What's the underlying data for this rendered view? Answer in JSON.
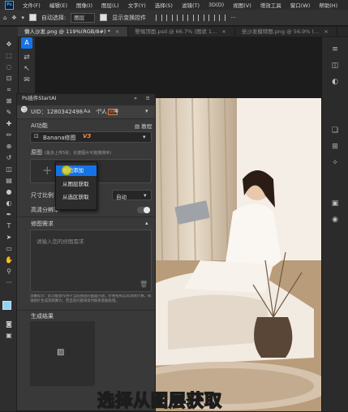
{
  "menubar": {
    "items": [
      "文件(F)",
      "编辑(E)",
      "图像(I)",
      "图层(L)",
      "文字(Y)",
      "选择(S)",
      "滤镜(T)",
      "3D(D)",
      "视图(V)",
      "增效工具",
      "窗口(W)",
      "帮助(H)"
    ]
  },
  "options": {
    "auto_select": "自动选择:",
    "layer_select": "图层",
    "show_transform": "显示变换控件"
  },
  "tabs": [
    {
      "label": "懒人沙发.png @ 119%(RGB/8#) *",
      "active": true
    },
    {
      "label": "警惕顶面.psd @ 66.7% (图状 1...",
      "active": false
    },
    {
      "label": "坐沙发模特图.png @ 56.9% (...",
      "active": false
    }
  ],
  "plugin": {
    "title": "Ps插件StartAI",
    "expand_label": "»",
    "menu_label": "≡",
    "uid_label": "UID：1280342498",
    "account_type": "个人",
    "vip_badge": "VIP",
    "ai_func_label": "AI功能",
    "tutorial_label": "教程",
    "model_name": "Banana修图",
    "model_badge": "V3",
    "original_label": "原图",
    "original_hint": "(最多上传5张，长按图片可拖拽排序)",
    "ratio_label": "尺寸比例",
    "ratio_value": "自动",
    "hires_label": "高清分辨率",
    "request_label": "修图需求",
    "request_placeholder": "请输入您的修图需求",
    "notice_text": "温馨提示：此功能会作用于当前图层的画面内容，价格按照实际消耗计算，每张图片生成消耗算力，若出现问题请及时联系客服处理。",
    "result_label": "生成结果"
  },
  "context_menu": {
    "items": [
      "本地添加",
      "从图层获取",
      "从选区获取"
    ],
    "selected_index": 0
  },
  "caption": {
    "text": "选择从图层获取"
  },
  "colors": {
    "accent_blue": "#1473e6",
    "ps_blue": "#31a8ff",
    "caption_yellow": "#ffe100",
    "vip_orange": "#e0783a",
    "foreground_swatch": "#8ed6f5"
  }
}
